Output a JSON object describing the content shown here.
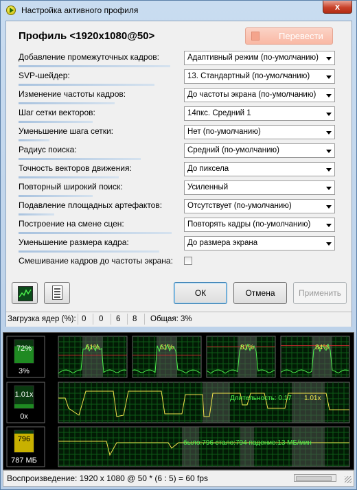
{
  "window": {
    "title": "Настройка активного профиля",
    "close_label": "x"
  },
  "profile": {
    "title": "Профиль <1920x1080@50>",
    "translate_label": "Перевести"
  },
  "settings": [
    {
      "label": "Добавление промежуточных кадров:",
      "value": "Адаптивный режим (по-умолчанию)",
      "level": 0.98
    },
    {
      "label": "SVP-шейдер:",
      "value": "13. Стандартный (по-умолчанию)",
      "level": 0.88
    },
    {
      "label": "Изменение частоты кадров:",
      "value": "До частоты экрана (по-умолчанию)",
      "level": 0.62
    },
    {
      "label": "Шаг сетки векторов:",
      "value": "14пкс. Средний 1",
      "level": 0.48
    },
    {
      "label": "Уменьшение шага сетки:",
      "value": "Нет (по-умолчанию)",
      "level": 0.2
    },
    {
      "label": "Радиус поиска:",
      "value": "Средний (по-умолчанию)",
      "level": 0.79
    },
    {
      "label": "Точность векторов движения:",
      "value": "До пиксела",
      "level": 0.65
    },
    {
      "label": "Повторный широкий поиск:",
      "value": "Усиленный",
      "level": 0.48
    },
    {
      "label": "Подавление площадных артефактов:",
      "value": "Отсутствует (по-умолчанию)",
      "level": 0.23
    },
    {
      "label": "Построение на смене сцен:",
      "value": "Повторять кадры (по-умолчанию)",
      "level": 0.99
    },
    {
      "label": "Уменьшение размера кадра:",
      "value": "До размера экрана",
      "level": 0.91
    }
  ],
  "checkbox": {
    "label": "Смешивание кадров до частоты экрана:",
    "checked": false
  },
  "buttons": {
    "ok": "ОК",
    "cancel": "Отмена",
    "apply": "Применить"
  },
  "status": {
    "cores_label": "Загрузка ядер (%):",
    "cores": [
      "0",
      "0",
      "6",
      "8"
    ],
    "total": "Общая: 3%"
  },
  "monitor": {
    "cpu": {
      "pct_top": "72%",
      "pct_bottom": "3%",
      "core_peaks": [
        "61%",
        "61%",
        "81%",
        "84%"
      ]
    },
    "ratio": {
      "top": "1.01x",
      "bottom": "0x",
      "duration_text": "Длительность: 0.17",
      "ratio_text": "1.01x"
    },
    "memory": {
      "top": "796",
      "bottom": "787 МБ",
      "stats_text": "было:796 стало:794 падение:13 МБ/мин"
    },
    "colors": {
      "line": "#4df24d",
      "accent": "#f2e34d",
      "grid": "#0e5a16",
      "band": "#555555"
    }
  },
  "bottom_status": "Воспроизведение: 1920 x 1080 @ 50 * (6 : 5) = 60 fps"
}
